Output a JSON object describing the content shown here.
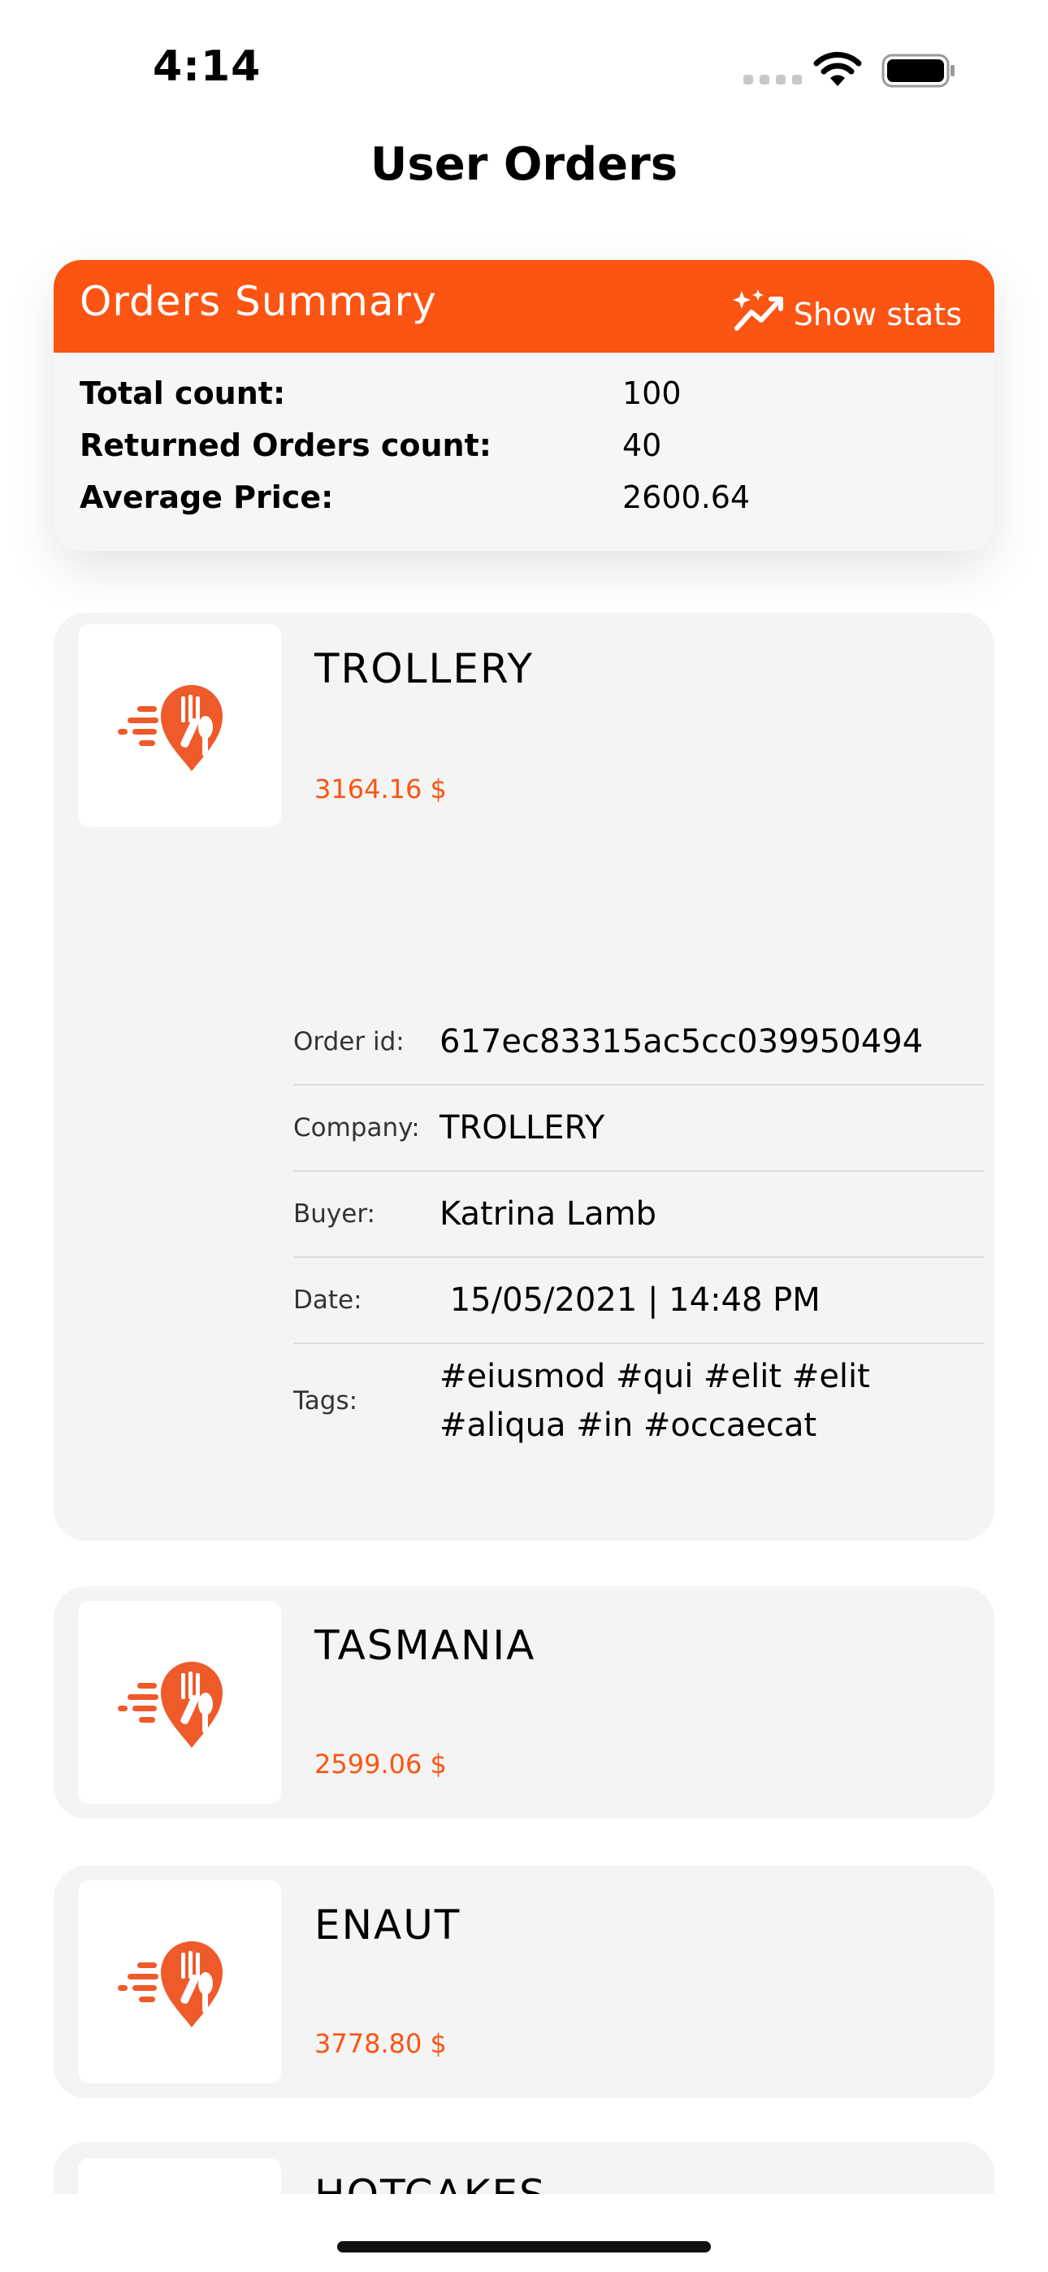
{
  "status_bar": {
    "time": "4:14"
  },
  "page": {
    "title": "User Orders"
  },
  "summary": {
    "title": "Orders Summary",
    "show_stats_label": "Show stats",
    "rows": [
      {
        "label": "Total count:",
        "value": "100"
      },
      {
        "label": "Returned Orders count:",
        "value": "40"
      },
      {
        "label": "Average Price:",
        "value": "2600.64"
      }
    ]
  },
  "orders": [
    {
      "name": "TROLLERY",
      "price": "3164.16 $",
      "details": {
        "order_id_label": "Order id:",
        "order_id": "617ec83315ac5cc039950494",
        "company_label": "Company:",
        "company": "TROLLERY",
        "buyer_label": "Buyer:",
        "buyer": "Katrina Lamb",
        "date_label": "Date:",
        "date": " 15/05/2021 | 14:48 PM",
        "tags_label": "Tags:",
        "tags": "#eiusmod #qui #elit #elit #aliqua #in #occaecat"
      }
    },
    {
      "name": "TASMANIA",
      "price": "2599.06 $"
    },
    {
      "name": "ENAUT",
      "price": "3778.80 $"
    },
    {
      "name": "HOTCAKES",
      "price": ""
    }
  ],
  "icons": {
    "brand": "food-delivery-logo-icon",
    "stats": "sparkle-chart-icon"
  },
  "colors": {
    "accent": "#fc5412",
    "card_bg": "#f4f4f4"
  }
}
